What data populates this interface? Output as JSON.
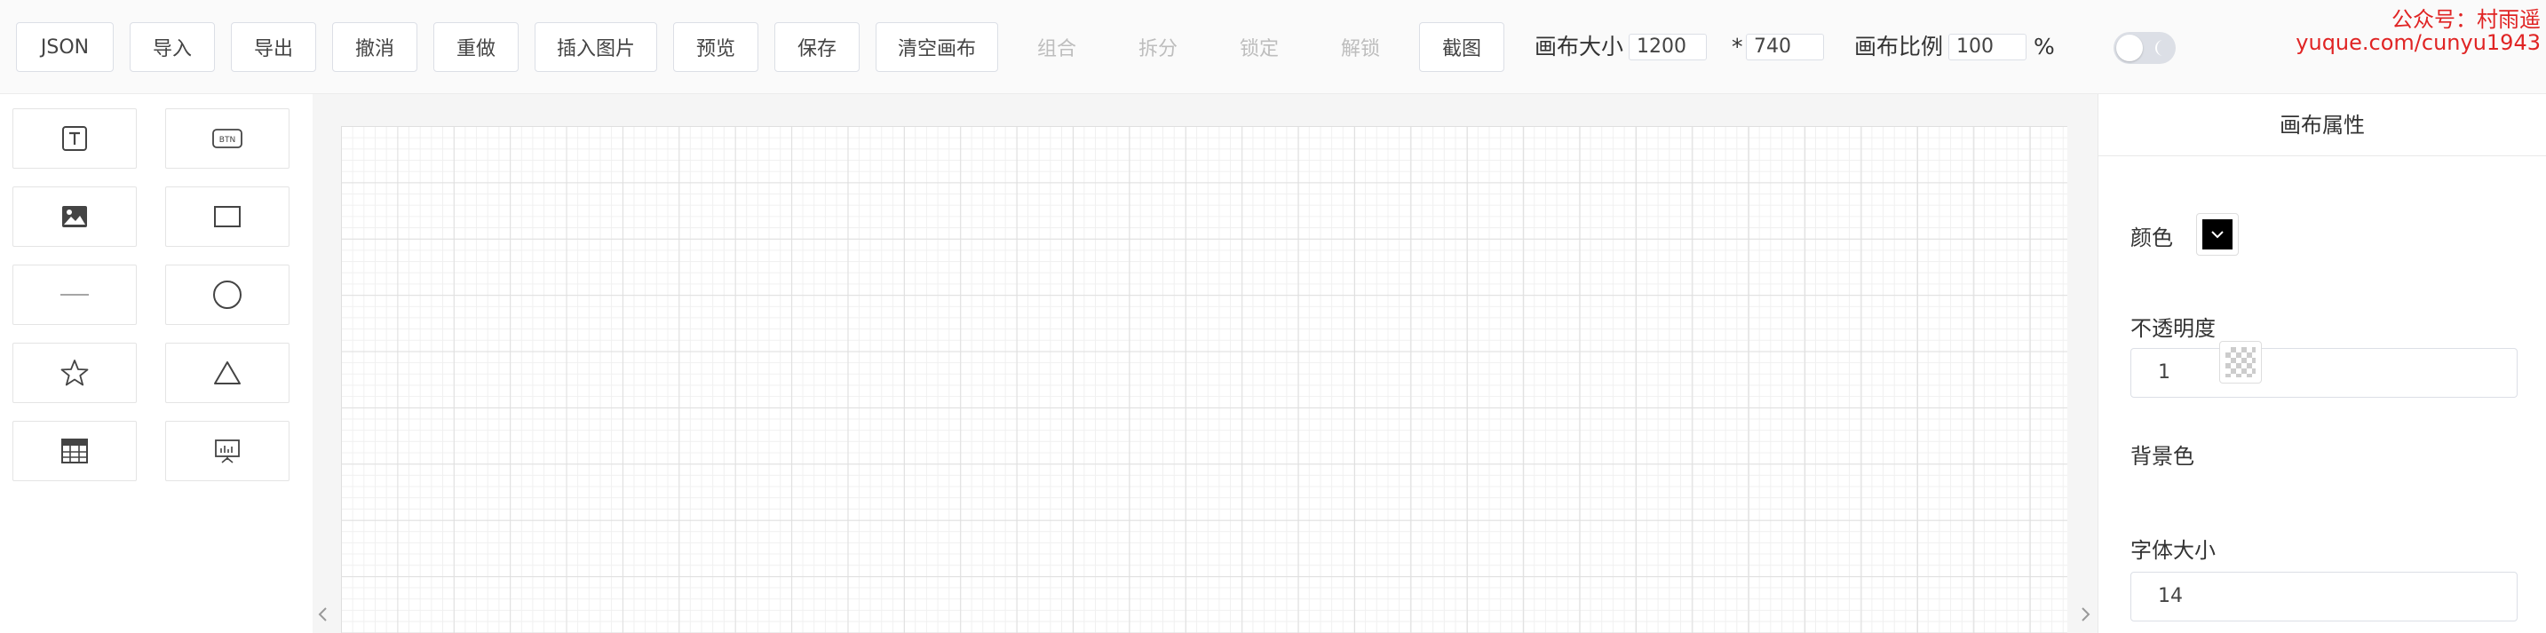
{
  "toolbar": {
    "buttons": {
      "json": "JSON",
      "import": "导入",
      "export": "导出",
      "undo": "撤消",
      "redo": "重做",
      "insert_image": "插入图片",
      "preview": "预览",
      "save": "保存",
      "clear_canvas": "清空画布",
      "group": "组合",
      "ungroup": "拆分",
      "lock": "锁定",
      "unlock": "解锁",
      "screenshot": "截图"
    },
    "canvas_size_label": "画布大小",
    "canvas_width": "1200",
    "size_separator": "*",
    "canvas_height": "740",
    "canvas_scale_label": "画布比例",
    "canvas_scale": "100",
    "percent_sign": "%",
    "dark_mode_on": false
  },
  "watermark": {
    "line1": "公众号：村雨遥",
    "line2": "yuque.com/cunyu1943"
  },
  "left_panel": {
    "tools": [
      {
        "icon": "text-icon"
      },
      {
        "icon": "button-icon",
        "text": "BTN"
      },
      {
        "icon": "image-icon"
      },
      {
        "icon": "rectangle-icon"
      },
      {
        "icon": "line-icon"
      },
      {
        "icon": "circle-icon"
      },
      {
        "icon": "star-icon"
      },
      {
        "icon": "triangle-icon"
      },
      {
        "icon": "table-icon"
      },
      {
        "icon": "chart-icon"
      }
    ]
  },
  "right_panel": {
    "title": "画布属性",
    "color_label": "颜色",
    "color_value": "#000000",
    "opacity_label": "不透明度",
    "opacity_value": "1",
    "background_label": "背景色",
    "font_size_label": "字体大小",
    "font_size_value": "14"
  },
  "colors": {
    "watermark": "#e02424",
    "grid_major": "#dfdfdf",
    "grid_minor": "#f0f0f0"
  }
}
